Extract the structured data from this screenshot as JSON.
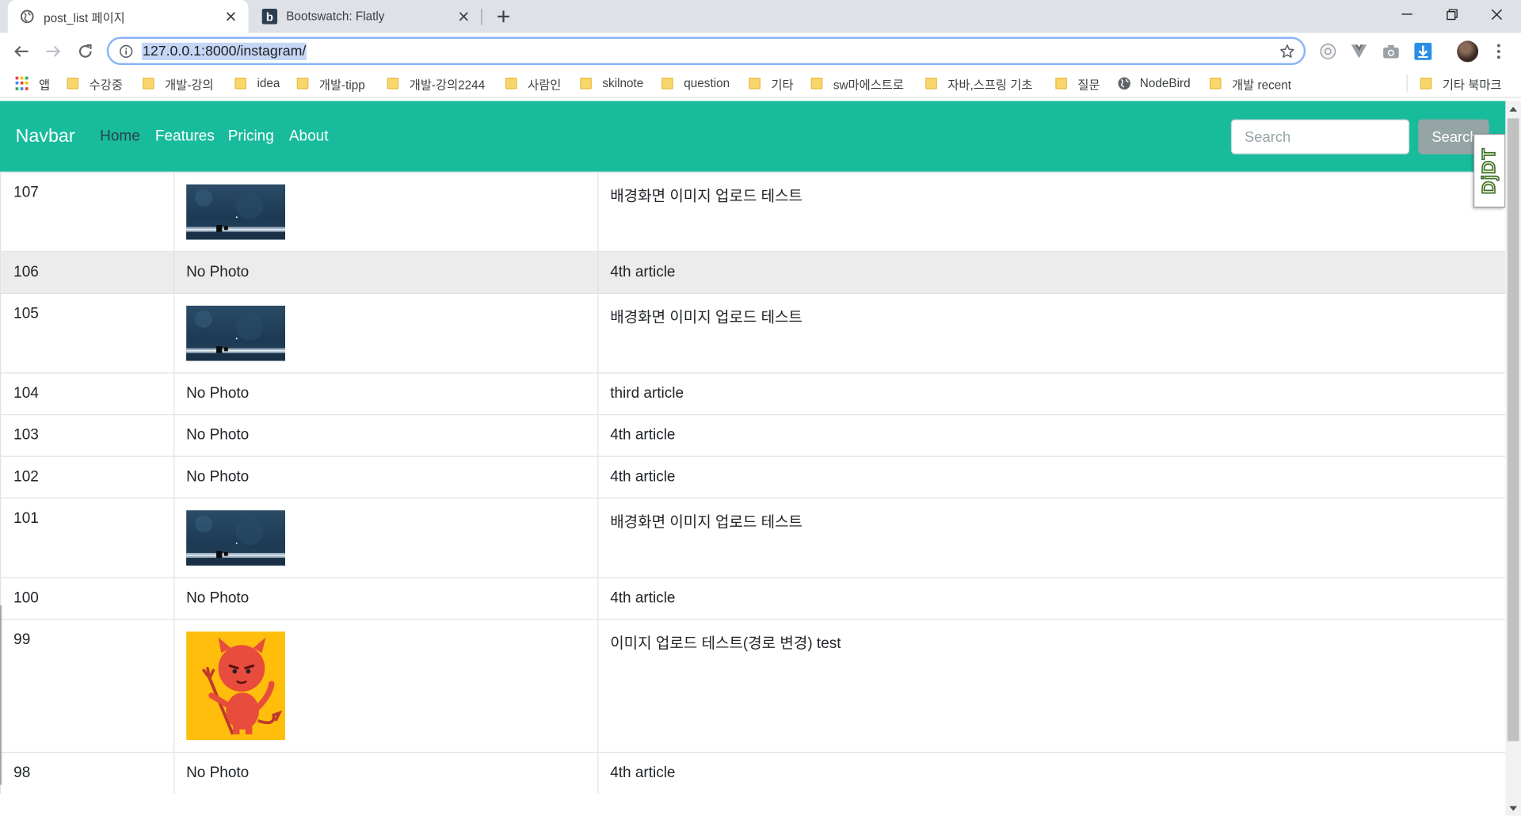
{
  "browser": {
    "tabs": [
      {
        "title": "post_list 페이지",
        "active": true
      },
      {
        "title": "Bootswatch: Flatly",
        "active": false,
        "favicon_letter": "b"
      }
    ],
    "address": "127.0.0.1:8000/instagram/",
    "bookmarks": [
      {
        "label": "앱",
        "icon": "apps-grid-icon"
      },
      {
        "label": "수강중",
        "icon": "folder-icon"
      },
      {
        "label": "개발-강의",
        "icon": "folder-icon"
      },
      {
        "label": "idea",
        "icon": "folder-icon"
      },
      {
        "label": "개발-tipp",
        "icon": "folder-icon"
      },
      {
        "label": "개발-강의2244",
        "icon": "folder-icon"
      },
      {
        "label": "사람인",
        "icon": "folder-icon"
      },
      {
        "label": "skilnote",
        "icon": "folder-icon"
      },
      {
        "label": "question",
        "icon": "folder-icon"
      },
      {
        "label": "기타",
        "icon": "folder-icon"
      },
      {
        "label": "sw마에스트로",
        "icon": "folder-icon"
      },
      {
        "label": "자바,스프링 기초",
        "icon": "folder-icon"
      },
      {
        "label": "질문",
        "icon": "folder-icon"
      },
      {
        "label": "NodeBird",
        "icon": "globe-icon"
      },
      {
        "label": "개발 recent",
        "icon": "folder-icon"
      },
      {
        "label": "기타 북마크",
        "icon": "folder-icon"
      }
    ]
  },
  "navbar": {
    "brand": "Navbar",
    "links": [
      "Home",
      "Features",
      "Pricing",
      "About"
    ],
    "active_link": "Home",
    "search_placeholder": "Search",
    "search_button": "Search",
    "colors": {
      "bg": "#18bc9c",
      "active_link": "#2c3e50",
      "search_button": "#95a5a6"
    }
  },
  "extension_badge": "DjDT",
  "posts": [
    {
      "id": "107",
      "photo": "image",
      "photo_kind": "night-sky",
      "caption": "배경화면 이미지 업로드 테스트"
    },
    {
      "id": "106",
      "photo": "No Photo",
      "caption": "4th article"
    },
    {
      "id": "105",
      "photo": "image",
      "photo_kind": "night-sky",
      "caption": "배경화면 이미지 업로드 테스트"
    },
    {
      "id": "104",
      "photo": "No Photo",
      "caption": "third article"
    },
    {
      "id": "103",
      "photo": "No Photo",
      "caption": "4th article"
    },
    {
      "id": "102",
      "photo": "No Photo",
      "caption": "4th article"
    },
    {
      "id": "101",
      "photo": "image",
      "photo_kind": "night-sky",
      "caption": "배경화면 이미지 업로드 테스트"
    },
    {
      "id": "100",
      "photo": "No Photo",
      "caption": "4th article"
    },
    {
      "id": "99",
      "photo": "image",
      "photo_kind": "red-devil",
      "caption": "이미지 업로드 테스트(경로 변경) test"
    },
    {
      "id": "98",
      "photo": "No Photo",
      "caption": "4th article"
    }
  ]
}
